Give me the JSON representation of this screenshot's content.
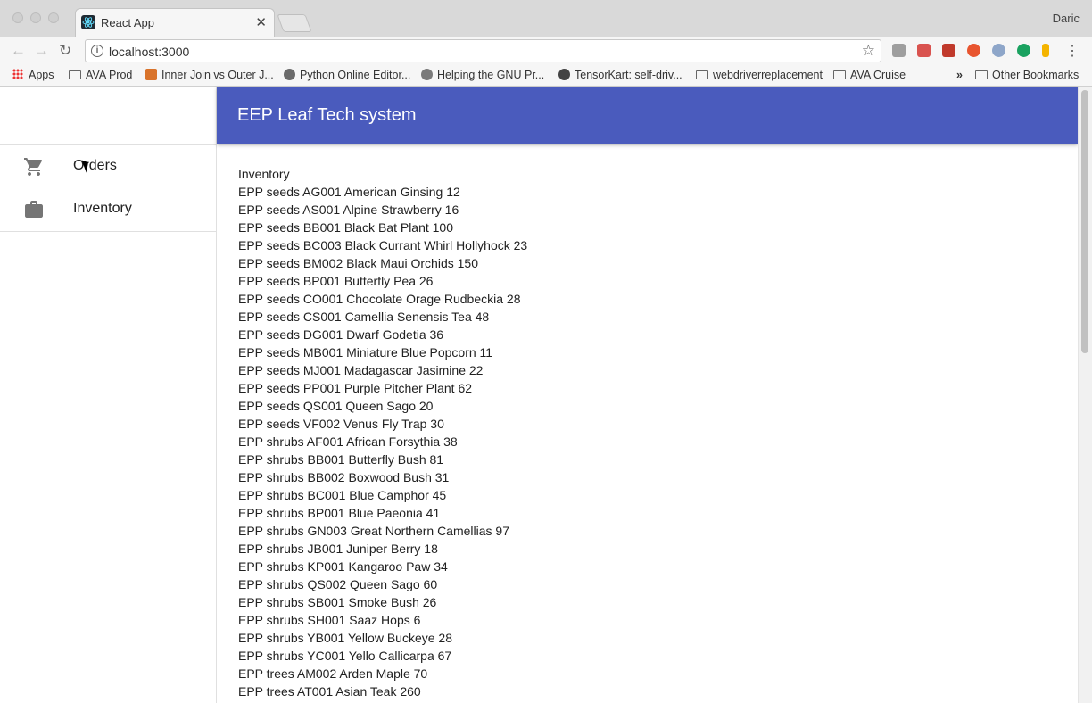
{
  "browser": {
    "tab_title": "React App",
    "tab_close": "✕",
    "profile_name": "Daric",
    "url": "localhost:3000",
    "bookmarks": [
      {
        "label": "Apps",
        "type": "apps"
      },
      {
        "label": "AVA Prod",
        "type": "folder"
      },
      {
        "label": "Inner Join vs Outer J...",
        "type": "site",
        "color": "#d9732b"
      },
      {
        "label": "Python Online Editor...",
        "type": "site",
        "color": "#6a6a6a"
      },
      {
        "label": "Helping the GNU Pr...",
        "type": "site",
        "color": "#7a7a7a"
      },
      {
        "label": "TensorKart: self-driv...",
        "type": "site",
        "color": "#444444"
      },
      {
        "label": "webdriverreplacement",
        "type": "folder"
      },
      {
        "label": "AVA Cruise",
        "type": "folder"
      },
      {
        "label": "Other Bookmarks",
        "type": "folder"
      }
    ],
    "overflow_chevron": "»"
  },
  "drawer": {
    "items": [
      {
        "label": "Orders",
        "icon": "cart-icon"
      },
      {
        "label": "Inventory",
        "icon": "briefcase-icon"
      }
    ]
  },
  "appbar": {
    "title": "EEP Leaf Tech system"
  },
  "content": {
    "heading": "Inventory",
    "items": [
      "EPP seeds AG001 American Ginsing 12",
      "EPP seeds AS001 Alpine Strawberry 16",
      "EPP seeds BB001 Black Bat Plant 100",
      "EPP seeds BC003 Black Currant Whirl Hollyhock 23",
      "EPP seeds BM002 Black Maui Orchids 150",
      "EPP seeds BP001 Butterfly Pea 26",
      "EPP seeds CO001 Chocolate Orage Rudbeckia 28",
      "EPP seeds CS001 Camellia Senensis Tea 48",
      "EPP seeds DG001 Dwarf Godetia 36",
      "EPP seeds MB001 Miniature Blue Popcorn 11",
      "EPP seeds MJ001 Madagascar Jasimine 22",
      "EPP seeds PP001 Purple Pitcher Plant 62",
      "EPP seeds QS001 Queen Sago 20",
      "EPP seeds VF002 Venus Fly Trap 30",
      "EPP shrubs AF001 African Forsythia 38",
      "EPP shrubs BB001 Butterfly Bush 81",
      "EPP shrubs BB002 Boxwood Bush 31",
      "EPP shrubs BC001 Blue Camphor 45",
      "EPP shrubs BP001 Blue Paeonia 41",
      "EPP shrubs GN003 Great Northern Camellias 97",
      "EPP shrubs JB001 Juniper Berry 18",
      "EPP shrubs KP001 Kangaroo Paw 34",
      "EPP shrubs QS002 Queen Sago 60",
      "EPP shrubs SB001 Smoke Bush 26",
      "EPP shrubs SH001 Saaz Hops 6",
      "EPP shrubs YB001 Yellow Buckeye 28",
      "EPP shrubs YC001 Yello Callicarpa 67",
      "EPP trees AM002 Arden Maple 70",
      "EPP trees AT001 Asian Teak 260"
    ]
  },
  "colors": {
    "appbar": "#4a5bbd",
    "text": "#212121",
    "icon": "#757575"
  }
}
